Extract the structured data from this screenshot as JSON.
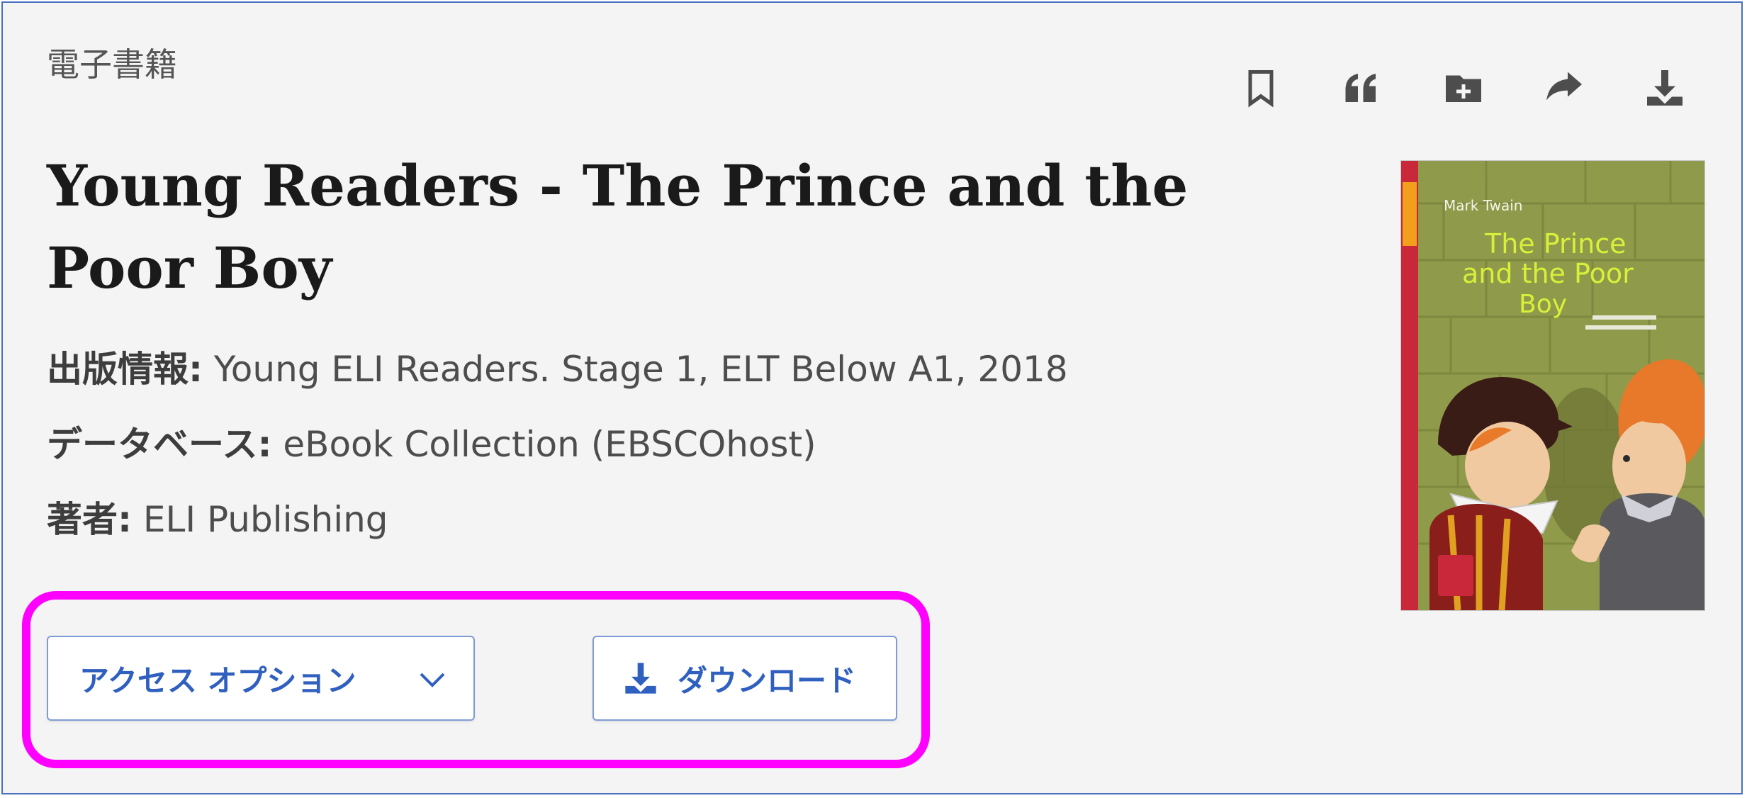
{
  "record": {
    "content_type": "電子書籍",
    "title": "Young Readers - The Prince and the Poor Boy",
    "fields": [
      {
        "label": "出版情報:",
        "value": " Young ELI Readers. Stage 1, ELT Below A1, 2018"
      },
      {
        "label": "データベース:",
        "value": " eBook Collection (EBSCOhost)"
      },
      {
        "label": "著者:",
        "value": " ELI Publishing"
      }
    ]
  },
  "toolbar": {
    "icons": [
      "bookmark-icon",
      "quote-icon",
      "add-folder-icon",
      "share-icon",
      "download-icon"
    ]
  },
  "cover": {
    "author": "Mark Twain",
    "title_lines": [
      "The Prince",
      "and the Poor",
      "Boy"
    ]
  },
  "actions": {
    "access_options_label": "アクセス オプション",
    "download_label": "ダウンロード"
  },
  "colors": {
    "accent": "#2f5fbf",
    "highlight": "#ff00ff",
    "panel_border": "#4a6fbf",
    "cover_green": "#8f9a4a",
    "cover_red": "#c8283a"
  }
}
